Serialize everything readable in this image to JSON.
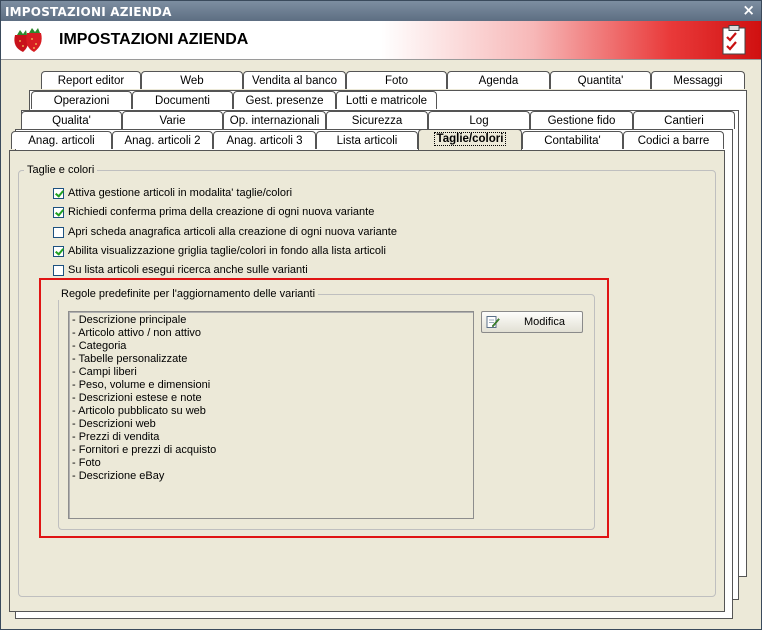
{
  "window": {
    "title": "IMPOSTAZIONI AZIENDA",
    "close": "×"
  },
  "header": {
    "title": "IMPOSTAZIONI AZIENDA"
  },
  "tabs": {
    "row1": [
      "Report editor",
      "Web",
      "Vendita al banco",
      "Foto",
      "Agenda",
      "Quantita'",
      "Messaggi"
    ],
    "row2": [
      "Operazioni",
      "Documenti",
      "Gest. presenze",
      "Lotti e matricole"
    ],
    "row3": [
      "Qualita'",
      "Varie",
      "Op. internazionali",
      "Sicurezza",
      "Log",
      "Gestione fido",
      "Cantieri"
    ],
    "row4": [
      "Anag. articoli",
      "Anag. articoli 2",
      "Anag. articoli 3",
      "Lista articoli",
      "Taglie/colori",
      "Contabilita'",
      "Codici a barre"
    ]
  },
  "group": {
    "title": "Taglie e colori"
  },
  "options": [
    {
      "label": "Attiva gestione articoli in modalita' taglie/colori",
      "checked": true
    },
    {
      "label": "Richiedi conferma prima della creazione di ogni nuova variante",
      "checked": true
    },
    {
      "label": "Apri scheda anagrafica articoli alla creazione di ogni nuova variante",
      "checked": false
    },
    {
      "label": "Abilita visualizzazione griglia taglie/colori in fondo alla lista articoli",
      "checked": true
    },
    {
      "label": "Su lista articoli esegui ricerca anche sulle varianti",
      "checked": false
    }
  ],
  "rules": {
    "title": "Regole predefinite per l'aggiornamento delle varianti",
    "items": [
      "- Descrizione principale",
      "- Articolo attivo / non attivo",
      "- Categoria",
      "- Tabelle personalizzate",
      "- Campi liberi",
      "- Peso, volume e dimensioni",
      "- Descrizioni estese e note",
      "- Articolo pubblicato su web",
      "- Descrizioni web",
      "- Prezzi di vendita",
      "- Fornitori e prezzi di acquisto",
      "- Foto",
      "- Descrizione eBay"
    ],
    "button_label": "Modifica"
  },
  "colors": {
    "highlight": "#e01414",
    "accent_red": "#d01010"
  }
}
